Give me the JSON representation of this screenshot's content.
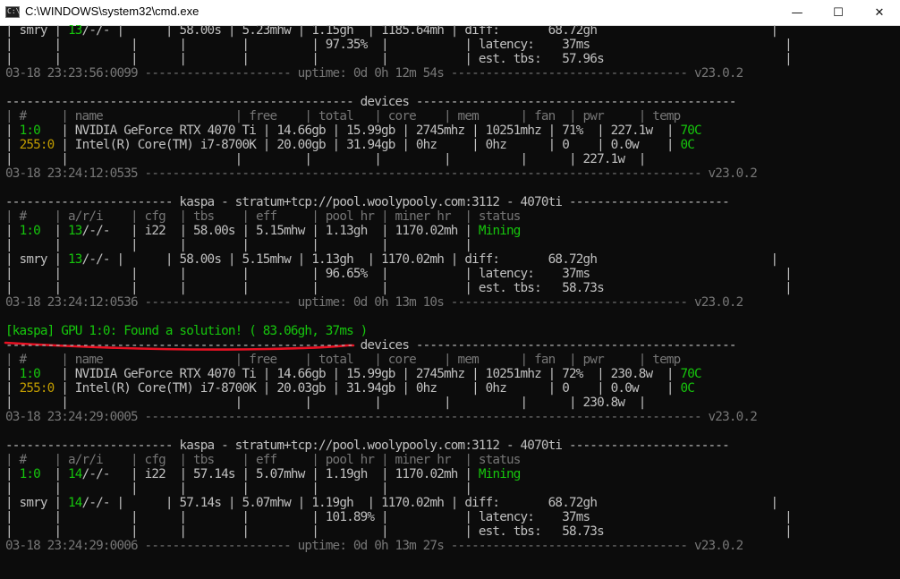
{
  "window": {
    "title": "C:\\WINDOWS\\system32\\cmd.exe",
    "controls": {
      "minimize": "—",
      "maximize": "☐",
      "close": "✕"
    }
  },
  "colors": {
    "background": "#0c0c0c",
    "text": "#c0c0c0",
    "green": "#16c60c",
    "amber": "#c19c00",
    "dim": "#767676",
    "annotation": "#e81123"
  },
  "console": {
    "lines": [
      {
        "segments": [
          {
            "t": "| smry | ",
            "c": "t"
          },
          {
            "t": "13",
            "c": "g"
          },
          {
            "t": "/-/- |      | 58.00s | 5.23mhw | 1.15gh  | 1185.64mh | diff:       68.72gh                         |",
            "c": "t"
          }
        ]
      },
      {
        "segments": [
          {
            "t": "|      |          |      |        |         | 97.35%  |           | latency:    37ms                            |",
            "c": "t"
          }
        ]
      },
      {
        "segments": [
          {
            "t": "|      |          |      |        |         |         |           | est. tbs:   57.96s                          |",
            "c": "t"
          }
        ]
      },
      {
        "segments": [
          {
            "t": "03-18 23:23:56:0099 --------------------- uptime: 0d 0h 12m 54s ---------------------------------- v23.0.2",
            "c": "d"
          }
        ]
      },
      {
        "segments": [
          {
            "t": "",
            "c": "t"
          }
        ]
      },
      {
        "segments": [
          {
            "t": "-------------------------------------------------- devices ----------------------------------------------",
            "c": "t"
          }
        ]
      },
      {
        "segments": [
          {
            "t": "| #     | name                   | free    | total   | core    | mem      | fan  | pwr     | temp",
            "c": "d"
          }
        ]
      },
      {
        "segments": [
          {
            "t": "| ",
            "c": "t"
          },
          {
            "t": "1:0",
            "c": "g"
          },
          {
            "t": "   | NVIDIA GeForce RTX 4070 Ti | 14.66gb | 15.99gb | 2745mhz | 10251mhz | 71%  | 227.1w  | ",
            "c": "t"
          },
          {
            "t": "70C",
            "c": "g"
          }
        ]
      },
      {
        "segments": [
          {
            "t": "| ",
            "c": "t"
          },
          {
            "t": "255:0",
            "c": "y"
          },
          {
            "t": " | Intel(R) Core(TM) i7-8700K | 20.00gb | 31.94gb | 0hz     | 0hz      | 0    | 0.0w    | ",
            "c": "t"
          },
          {
            "t": "0C",
            "c": "g"
          }
        ]
      },
      {
        "segments": [
          {
            "t": "|       |                        |         |         |         |          |      | 227.1w  |",
            "c": "t"
          }
        ]
      },
      {
        "segments": [
          {
            "t": "03-18 23:24:12:0535 -------------------------------------------------------------------------------- v23.0.2",
            "c": "d"
          }
        ]
      },
      {
        "segments": [
          {
            "t": "",
            "c": "t"
          }
        ]
      },
      {
        "segments": [
          {
            "t": "------------------------ kaspa - stratum+tcp://pool.woolypooly.com:3112 - 4070ti -----------------------",
            "c": "t"
          }
        ]
      },
      {
        "segments": [
          {
            "t": "| #    | a/r/i    | cfg  | tbs    | eff     | pool hr | miner hr  | status",
            "c": "d"
          }
        ]
      },
      {
        "segments": [
          {
            "t": "| ",
            "c": "t"
          },
          {
            "t": "1:0",
            "c": "g"
          },
          {
            "t": "  | ",
            "c": "t"
          },
          {
            "t": "13",
            "c": "g"
          },
          {
            "t": "/-/-   | i22  | 58.00s | 5.15mhw | 1.13gh  | 1170.02mh | ",
            "c": "t"
          },
          {
            "t": "Mining",
            "c": "g"
          }
        ]
      },
      {
        "segments": [
          {
            "t": "|      |          |      |        |         |         |           |",
            "c": "t"
          }
        ]
      },
      {
        "segments": [
          {
            "t": "| smry | ",
            "c": "t"
          },
          {
            "t": "13",
            "c": "g"
          },
          {
            "t": "/-/- |      | 58.00s | 5.15mhw | 1.13gh  | 1170.02mh | diff:       68.72gh                         |",
            "c": "t"
          }
        ]
      },
      {
        "segments": [
          {
            "t": "|      |          |      |        |         | 96.65%  |           | latency:    37ms                            |",
            "c": "t"
          }
        ]
      },
      {
        "segments": [
          {
            "t": "|      |          |      |        |         |         |           | est. tbs:   58.73s                          |",
            "c": "t"
          }
        ]
      },
      {
        "segments": [
          {
            "t": "03-18 23:24:12:0536 --------------------- uptime: 0d 0h 13m 10s ---------------------------------- v23.0.2",
            "c": "d"
          }
        ]
      },
      {
        "segments": [
          {
            "t": "",
            "c": "t"
          }
        ]
      },
      {
        "segments": [
          {
            "t": "[kaspa] GPU 1:0: Found a solution! ( 83.06gh, 37ms )",
            "c": "g"
          }
        ]
      },
      {
        "segments": [
          {
            "t": "-------------------------------------------------- devices ----------------------------------------------",
            "c": "t"
          }
        ]
      },
      {
        "segments": [
          {
            "t": "| #     | name                   | free    | total   | core    | mem      | fan  | pwr     | temp",
            "c": "d"
          }
        ]
      },
      {
        "segments": [
          {
            "t": "| ",
            "c": "t"
          },
          {
            "t": "1:0",
            "c": "g"
          },
          {
            "t": "   | NVIDIA GeForce RTX 4070 Ti | 14.66gb | 15.99gb | 2745mhz | 10251mhz | 72%  | 230.8w  | ",
            "c": "t"
          },
          {
            "t": "70C",
            "c": "g"
          }
        ]
      },
      {
        "segments": [
          {
            "t": "| ",
            "c": "t"
          },
          {
            "t": "255:0",
            "c": "y"
          },
          {
            "t": " | Intel(R) Core(TM) i7-8700K | 20.03gb | 31.94gb | 0hz     | 0hz      | 0    | 0.0w    | ",
            "c": "t"
          },
          {
            "t": "0C",
            "c": "g"
          }
        ]
      },
      {
        "segments": [
          {
            "t": "|       |                        |         |         |         |          |      | 230.8w  |",
            "c": "t"
          }
        ]
      },
      {
        "segments": [
          {
            "t": "03-18 23:24:29:0005 -------------------------------------------------------------------------------- v23.0.2",
            "c": "d"
          }
        ]
      },
      {
        "segments": [
          {
            "t": "",
            "c": "t"
          }
        ]
      },
      {
        "segments": [
          {
            "t": "------------------------ kaspa - stratum+tcp://pool.woolypooly.com:3112 - 4070ti -----------------------",
            "c": "t"
          }
        ]
      },
      {
        "segments": [
          {
            "t": "| #    | a/r/i    | cfg  | tbs    | eff     | pool hr | miner hr  | status",
            "c": "d"
          }
        ]
      },
      {
        "segments": [
          {
            "t": "| ",
            "c": "t"
          },
          {
            "t": "1:0",
            "c": "g"
          },
          {
            "t": "  | ",
            "c": "t"
          },
          {
            "t": "14",
            "c": "g"
          },
          {
            "t": "/-/-   | i22  | 57.14s | 5.07mhw | 1.19gh  | 1170.02mh | ",
            "c": "t"
          },
          {
            "t": "Mining",
            "c": "g"
          }
        ]
      },
      {
        "segments": [
          {
            "t": "|      |          |      |        |         |         |           |",
            "c": "t"
          }
        ]
      },
      {
        "segments": [
          {
            "t": "| smry | ",
            "c": "t"
          },
          {
            "t": "14",
            "c": "g"
          },
          {
            "t": "/-/- |      | 57.14s | 5.07mhw | 1.19gh  | 1170.02mh | diff:       68.72gh                         |",
            "c": "t"
          }
        ]
      },
      {
        "segments": [
          {
            "t": "|      |          |      |        |         | 101.89% |           | latency:    37ms                            |",
            "c": "t"
          }
        ]
      },
      {
        "segments": [
          {
            "t": "|      |          |      |        |         |         |           | est. tbs:   58.73s                          |",
            "c": "t"
          }
        ]
      },
      {
        "segments": [
          {
            "t": "03-18 23:24:29:0006 --------------------- uptime: 0d 0h 13m 27s ---------------------------------- v23.0.2",
            "c": "d"
          }
        ]
      }
    ]
  }
}
